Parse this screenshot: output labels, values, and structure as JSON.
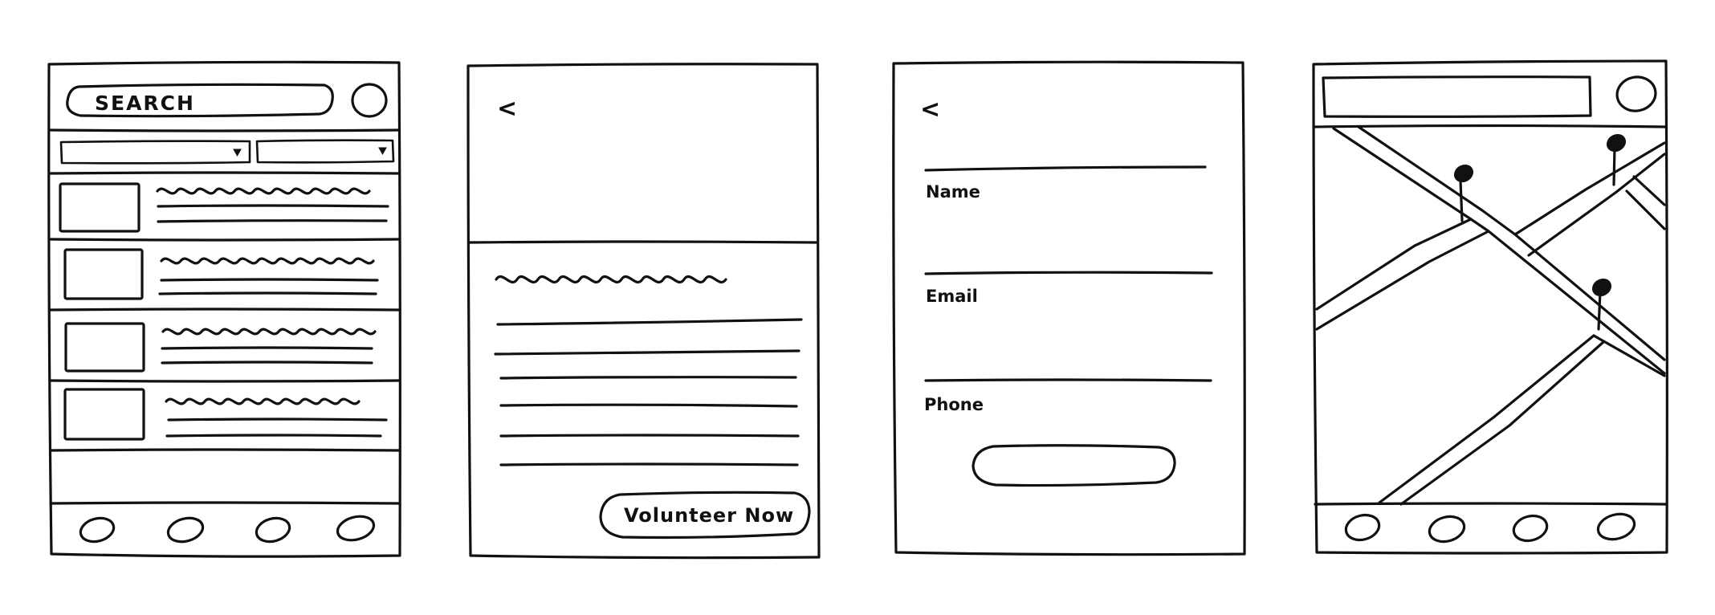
{
  "screens": {
    "list": {
      "search_label": "SEARCH"
    },
    "detail": {
      "back_glyph": "<",
      "volunteer_button_label": "Volunteer Now"
    },
    "form": {
      "back_glyph": "<",
      "fields": [
        {
          "label": "Name"
        },
        {
          "label": "Email"
        },
        {
          "label": "Phone"
        }
      ]
    },
    "map": {}
  }
}
